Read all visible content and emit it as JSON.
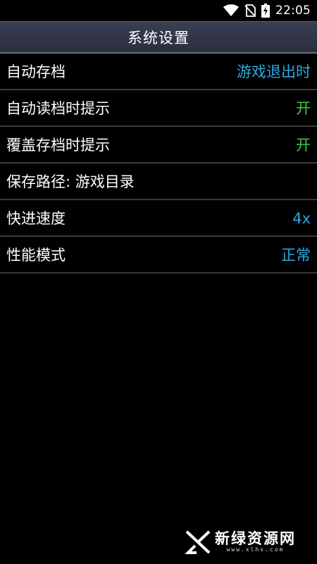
{
  "status_bar": {
    "time": "22:05",
    "icons": [
      "wifi-icon",
      "no-sim-icon",
      "battery-charging-icon"
    ]
  },
  "header": {
    "title": "系统设置"
  },
  "settings": [
    {
      "label": "自动存档",
      "value": "游戏退出时",
      "value_color": "#2fa9e0"
    },
    {
      "label": "自动读档时提示",
      "value": "开",
      "value_color": "#3fc64a"
    },
    {
      "label": "覆盖存档时提示",
      "value": "开",
      "value_color": "#3fc64a"
    },
    {
      "label": "保存路径: 游戏目录",
      "value": "",
      "value_color": "#2fa9e0"
    },
    {
      "label": "快进速度",
      "value": "4x",
      "value_color": "#2fa9e0"
    },
    {
      "label": "性能模式",
      "value": "正常",
      "value_color": "#2fa9e0"
    }
  ],
  "watermark": {
    "name": "新绿资源网",
    "url": "www.xlhs.com"
  }
}
